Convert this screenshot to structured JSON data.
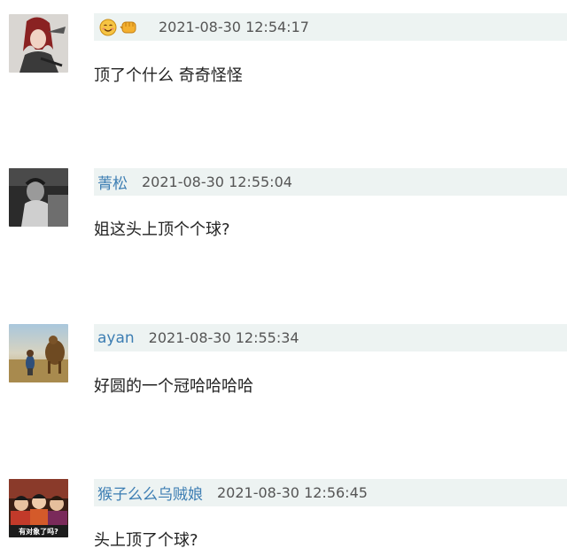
{
  "comments": [
    {
      "user": "",
      "user_icons": [
        "smile-emoji-icon",
        "fist-emoji-icon"
      ],
      "time": "2021-08-30 12:54:17",
      "text": "顶了个什么 奇奇怪怪"
    },
    {
      "user": "菁松",
      "time": "2021-08-30 12:55:04",
      "text": "姐这头上顶个个球?"
    },
    {
      "user": "ayan",
      "time": "2021-08-30 12:55:34",
      "text": "好圆的一个冠哈哈哈哈"
    },
    {
      "user": "猴子么么乌贼娘",
      "time": "2021-08-30 12:56:45",
      "text": "头上顶了个球?",
      "avatar_caption": "有对象了吗?"
    }
  ],
  "colors": {
    "meta_background": "#edf3f2",
    "username": "#3d7eb3",
    "timestamp": "#555555",
    "text": "#222222"
  }
}
